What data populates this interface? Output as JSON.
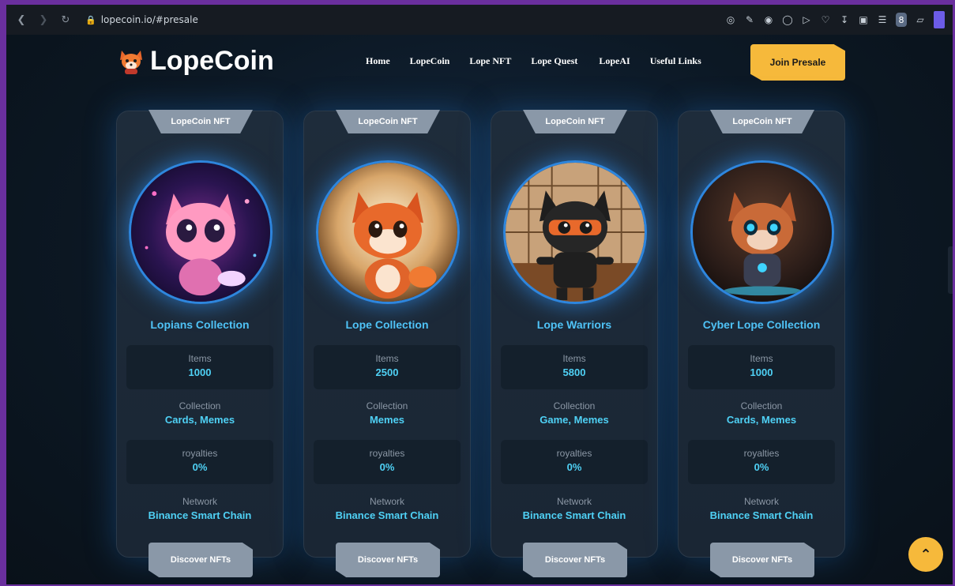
{
  "browser": {
    "url": "lopecoin.io/#presale",
    "profile_initial": "8"
  },
  "header": {
    "logo_text": "LopeCoin",
    "nav": [
      "Home",
      "LopeCoin",
      "Lope NFT",
      "Lope Quest",
      "LopeAI",
      "Useful Links"
    ],
    "cta_label": "Join Presale"
  },
  "cards": [
    {
      "tab": "LopeCoin NFT",
      "title": "Lopians Collection",
      "items_label": "Items",
      "items_value": "1000",
      "collection_label": "Collection",
      "collection_value": "Cards, Memes",
      "royalties_label": "royalties",
      "royalties_value": "0%",
      "network_label": "Network",
      "network_value": "Binance Smart Chain",
      "button": "Discover NFTs"
    },
    {
      "tab": "LopeCoin NFT",
      "title": "Lope Collection",
      "items_label": "Items",
      "items_value": "2500",
      "collection_label": "Collection",
      "collection_value": "Memes",
      "royalties_label": "royalties",
      "royalties_value": "0%",
      "network_label": "Network",
      "network_value": "Binance Smart Chain",
      "button": "Discover NFTs"
    },
    {
      "tab": "LopeCoin NFT",
      "title": "Lope Warriors",
      "items_label": "Items",
      "items_value": "5800",
      "collection_label": "Collection",
      "collection_value": "Game, Memes",
      "royalties_label": "royalties",
      "royalties_value": "0%",
      "network_label": "Network",
      "network_value": "Binance Smart Chain",
      "button": "Discover NFTs"
    },
    {
      "tab": "LopeCoin NFT",
      "title": "Cyber Lope Collection",
      "items_label": "Items",
      "items_value": "1000",
      "collection_label": "Collection",
      "collection_value": "Cards, Memes",
      "royalties_label": "royalties",
      "royalties_value": "0%",
      "network_label": "Network",
      "network_value": "Binance Smart Chain",
      "button": "Discover NFTs"
    }
  ],
  "colors": {
    "accent": "#f6b93b",
    "value_text": "#4fd1f5",
    "title_text": "#4fc3f7",
    "glow": "#2e86de",
    "card_bg": "#1e2c3b"
  },
  "icons": {
    "scroll_top": "chevron-up-icon",
    "logo": "fox-logo-icon"
  }
}
